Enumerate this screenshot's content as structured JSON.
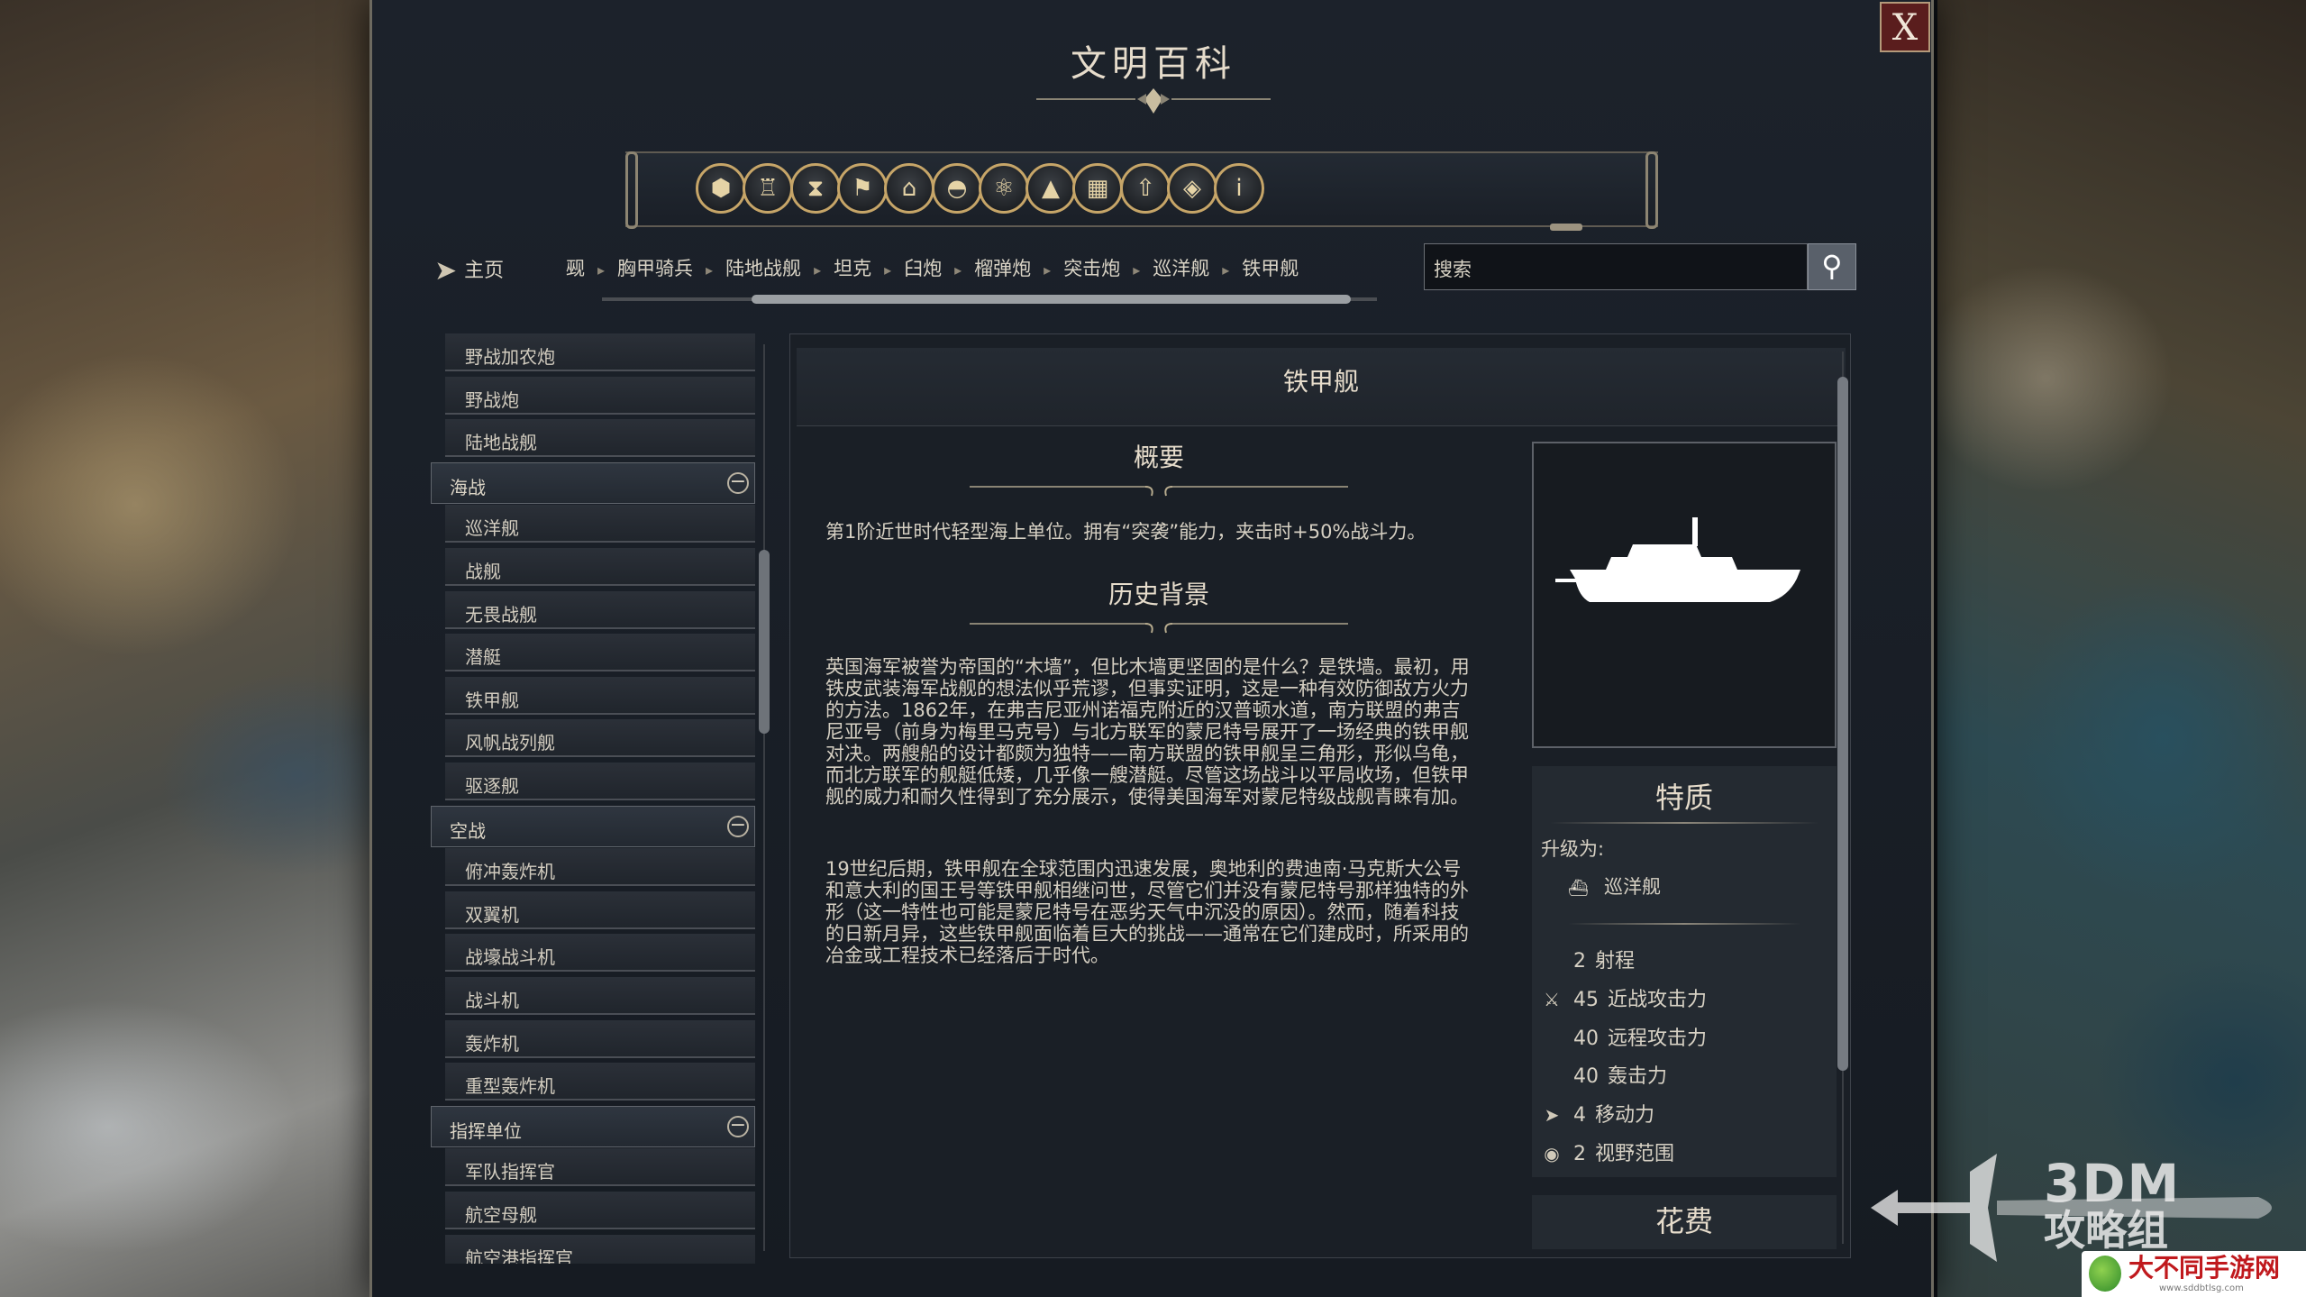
{
  "window": {
    "title": "文明百科",
    "close_label": "X"
  },
  "category_icons": [
    {
      "name": "resources-icon",
      "glyph": "⬢"
    },
    {
      "name": "goblet-icon",
      "glyph": "♖"
    },
    {
      "name": "hourglass-icon",
      "glyph": "⧗"
    },
    {
      "name": "flag-icon",
      "glyph": "⚑"
    },
    {
      "name": "temple-icon",
      "glyph": "⌂"
    },
    {
      "name": "dome-icon",
      "glyph": "◓"
    },
    {
      "name": "atom-icon",
      "glyph": "⚛"
    },
    {
      "name": "mountain-icon",
      "glyph": "▲"
    },
    {
      "name": "building-icon",
      "glyph": "▦"
    },
    {
      "name": "upgrade-arrow-icon",
      "glyph": "⇧"
    },
    {
      "name": "book-icon",
      "glyph": "◈"
    },
    {
      "name": "info-icon",
      "glyph": "i"
    }
  ],
  "nav": {
    "home_label": "主页",
    "breadcrumbs": [
      "觋",
      "胸甲骑兵",
      "陆地战舰",
      "坦克",
      "臼炮",
      "榴弹炮",
      "突击炮",
      "巡洋舰",
      "铁甲舰"
    ],
    "search_placeholder": "搜索"
  },
  "sidebar": {
    "items": [
      {
        "type": "item",
        "label": "野战加农炮"
      },
      {
        "type": "item",
        "label": "野战炮"
      },
      {
        "type": "item",
        "label": "陆地战舰"
      },
      {
        "type": "category",
        "label": "海战",
        "toggle": "−"
      },
      {
        "type": "item",
        "label": "巡洋舰"
      },
      {
        "type": "item",
        "label": "战舰"
      },
      {
        "type": "item",
        "label": "无畏战舰"
      },
      {
        "type": "item",
        "label": "潜艇"
      },
      {
        "type": "item",
        "label": "铁甲舰"
      },
      {
        "type": "item",
        "label": "风帆战列舰"
      },
      {
        "type": "item",
        "label": "驱逐舰"
      },
      {
        "type": "category",
        "label": "空战",
        "toggle": "−"
      },
      {
        "type": "item",
        "label": "俯冲轰炸机"
      },
      {
        "type": "item",
        "label": "双翼机"
      },
      {
        "type": "item",
        "label": "战壕战斗机"
      },
      {
        "type": "item",
        "label": "战斗机"
      },
      {
        "type": "item",
        "label": "轰炸机"
      },
      {
        "type": "item",
        "label": "重型轰炸机"
      },
      {
        "type": "category",
        "label": "指挥单位",
        "toggle": "−"
      },
      {
        "type": "item",
        "label": "军队指挥官"
      },
      {
        "type": "item",
        "label": "航空母舰"
      },
      {
        "type": "item",
        "label": "航空港指挥官"
      }
    ]
  },
  "article": {
    "title": "铁甲舰",
    "summary_heading": "概要",
    "summary_text": "第1阶近世时代轻型海上单位。拥有“突袭”能力，夹击时+50%战斗力。",
    "history_heading": "历史背景",
    "history_p1": "英国海军被誉为帝国的“木墙”，但比木墙更坚固的是什么？是铁墙。最初，用铁皮武装海军战舰的想法似乎荒谬，但事实证明，这是一种有效防御敌方火力的方法。1862年，在弗吉尼亚州诺福克附近的汉普顿水道，南方联盟的弗吉尼亚号（前身为梅里马克号）与北方联军的蒙尼特号展开了一场经典的铁甲舰对决。两艘船的设计都颇为独特——南方联盟的铁甲舰呈三角形，形似乌龟，而北方联军的舰艇低矮，几乎像一艘潜艇。尽管这场战斗以平局收场，但铁甲舰的威力和耐久性得到了充分展示，使得美国海军对蒙尼特级战舰青睐有加。",
    "history_p2": "19世纪后期，铁甲舰在全球范围内迅速发展，奥地利的费迪南·马克斯大公号和意大利的国王号等铁甲舰相继问世，尽管它们并没有蒙尼特号那样独特的外形（这一特性也可能是蒙尼特号在恶劣天气中沉没的原因）。然而，随着科技的日新月异，这些铁甲舰面临着巨大的挑战——通常在它们建成时，所采用的冶金或工程技术已经落后于时代。"
  },
  "traits": {
    "title": "特质",
    "upgrade_label": "升级为:",
    "upgrade_target": "巡洋舰",
    "stats": [
      {
        "icon": "",
        "value": "2",
        "label": "射程"
      },
      {
        "icon": "sword-icon",
        "value": "45",
        "label": "近战攻击力"
      },
      {
        "icon": "",
        "value": "40",
        "label": "远程攻击力"
      },
      {
        "icon": "",
        "value": "40",
        "label": "轰击力"
      },
      {
        "icon": "movement-arrow-icon",
        "value": "4",
        "label": "移动力"
      },
      {
        "icon": "eye-icon",
        "value": "2",
        "label": "视野范围"
      }
    ],
    "cost_title": "花费"
  },
  "watermarks": {
    "brand_line1": "3DM",
    "brand_line2": "攻略组",
    "site_name": "大不同手游网",
    "site_url": "www.sddbtlsg.com"
  }
}
